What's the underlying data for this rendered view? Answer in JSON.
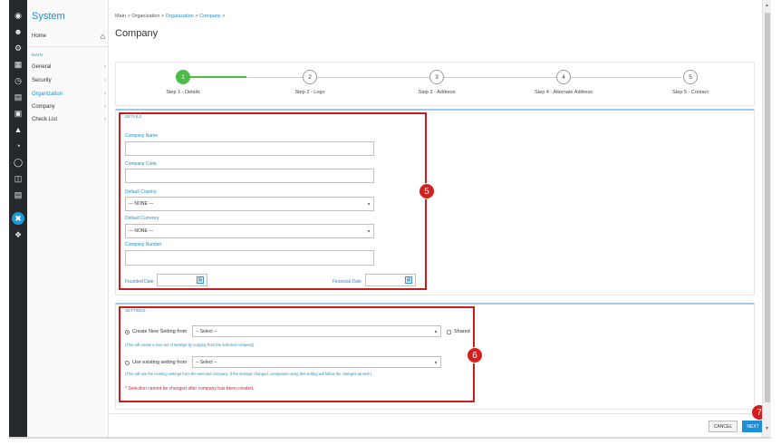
{
  "rail_icons": [
    "dashboard-icon",
    "users-icon",
    "gear-icon",
    "calendar-icon",
    "clock-icon",
    "clipboard-icon",
    "truck-icon",
    "bell-icon",
    "pie-icon",
    "circle-icon",
    "file-icon",
    "server-icon",
    "tools-icon",
    "help-icon"
  ],
  "nav": {
    "title": "System",
    "home": "Home",
    "home_icon": "⌂",
    "section": "MAIN",
    "items": [
      {
        "label": "General",
        "chevron": "›"
      },
      {
        "label": "Security",
        "chevron": "›"
      },
      {
        "label": "Organization",
        "chevron": "›"
      },
      {
        "label": "Company",
        "chevron": "›"
      },
      {
        "label": "Check List",
        "chevron": "›"
      }
    ]
  },
  "breadcrumb": {
    "main": "Main",
    "org": "Organization",
    "org_link": "Organization",
    "company": "Company",
    "sep": ">"
  },
  "page_title": "Company",
  "wizard": {
    "steps": [
      {
        "num": "1",
        "label": "Step 1 - Details"
      },
      {
        "num": "2",
        "label": "Step 2 - Logo"
      },
      {
        "num": "3",
        "label": "Step 3 - Address"
      },
      {
        "num": "4",
        "label": "Step 4 - Alternate Address"
      },
      {
        "num": "5",
        "label": "Step 5 - Contact"
      }
    ],
    "active_color": "#4cbb4a"
  },
  "details": {
    "title": "DETAILS",
    "company_name_label": "Company Name",
    "company_code_label": "Company Code",
    "default_country_label": "Default Country",
    "default_country_value": "--- NONE ---",
    "default_currency_label": "Default Currency",
    "default_currency_value": "--- NONE ---",
    "company_number_label": "Company Number",
    "founded_date_label": "Founded Date",
    "financial_date_label": "Financial Date"
  },
  "settings": {
    "title": "SETTINGS",
    "create_label": "Create New Setting from",
    "create_select": "-- Select --",
    "shared_label": "Shared",
    "create_hint": "(This will create a new set of settings by copying from the selected company)",
    "use_label": "Use existing setting from",
    "use_select": "-- Select --",
    "use_hint": "(This will use the existing settings from the selected company. If the settings changed, companies using this setting will follow the changes as well.)",
    "warning": "* Selection cannot be changed after company has been created."
  },
  "callouts": {
    "details": "5",
    "settings": "6",
    "next": "7"
  },
  "footer": {
    "cancel": "CANCEL",
    "next": "NEXT"
  },
  "colors": {
    "accent": "#1e8fc7",
    "callout": "#c91d1d",
    "rail": "#26292c"
  },
  "caret": "▼",
  "cal_glyph": "▦"
}
